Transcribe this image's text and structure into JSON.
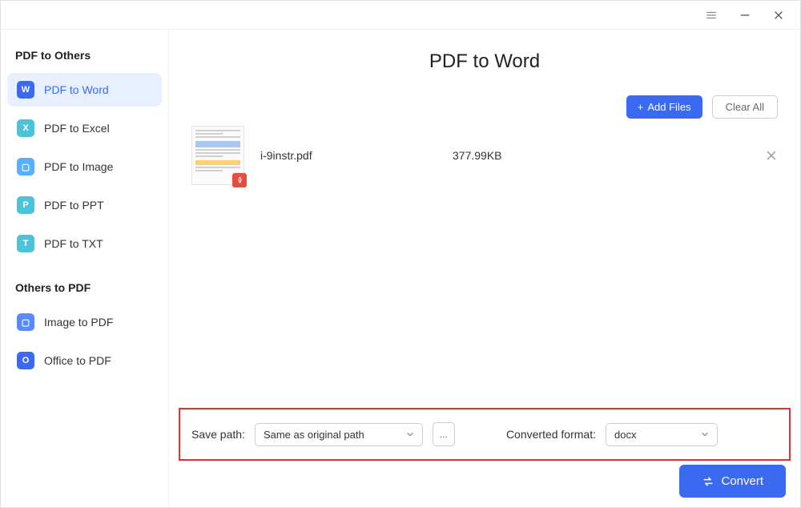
{
  "titlebar": {
    "menu": "menu",
    "minimize": "minimize",
    "close": "close"
  },
  "sidebar": {
    "section1_title": "PDF to Others",
    "section2_title": "Others to PDF",
    "items1": [
      {
        "label": "PDF to Word",
        "icon": "W",
        "active": true
      },
      {
        "label": "PDF to Excel",
        "icon": "X",
        "active": false
      },
      {
        "label": "PDF to Image",
        "icon": "▢",
        "active": false
      },
      {
        "label": "PDF to PPT",
        "icon": "P",
        "active": false
      },
      {
        "label": "PDF to TXT",
        "icon": "T",
        "active": false
      }
    ],
    "items2": [
      {
        "label": "Image to PDF",
        "icon": "▢",
        "active": false
      },
      {
        "label": "Office to PDF",
        "icon": "O",
        "active": false
      }
    ]
  },
  "header": {
    "title": "PDF to Word"
  },
  "actions": {
    "add_files": "Add Files",
    "clear_all": "Clear All"
  },
  "files": [
    {
      "name": "i-9instr.pdf",
      "size": "377.99KB"
    }
  ],
  "bottom": {
    "save_path_label": "Save path:",
    "save_path_value": "Same as original path",
    "browse": "...",
    "format_label": "Converted format:",
    "format_value": "docx"
  },
  "convert": {
    "label": "Convert"
  }
}
